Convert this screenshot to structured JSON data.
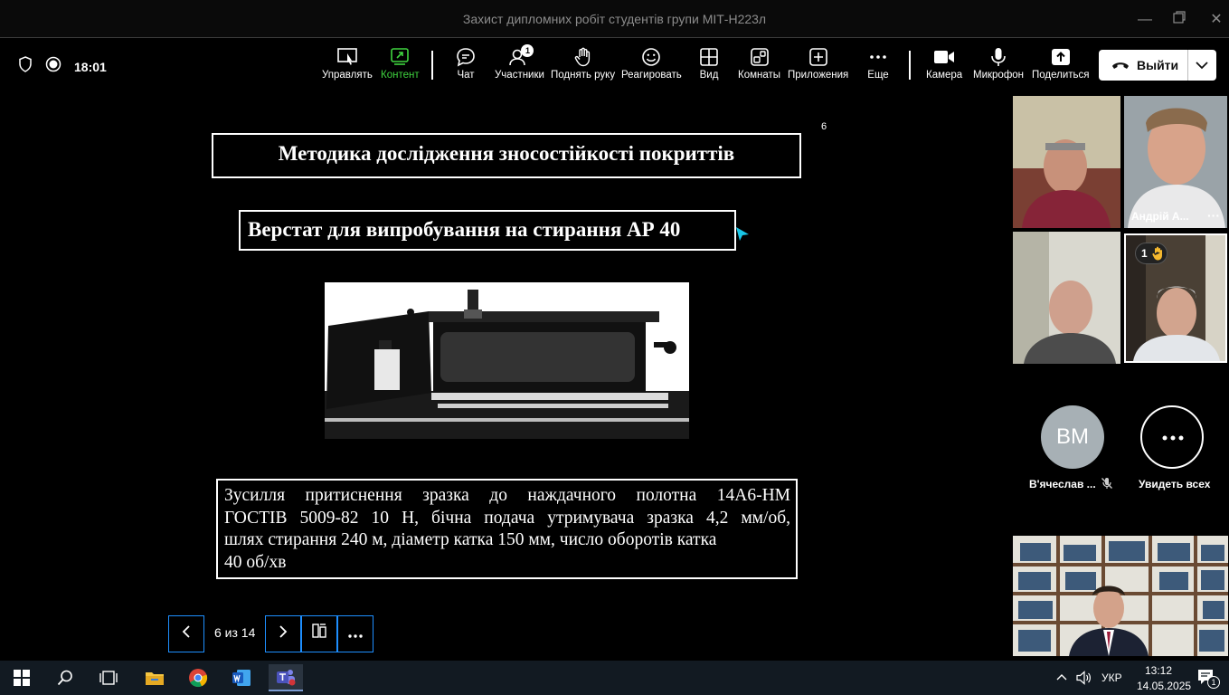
{
  "window": {
    "title": "Захист дипломних робіт студентів групи МІТ-Н223л"
  },
  "status": {
    "time": "18:01"
  },
  "toolbar": {
    "items": [
      {
        "label": "Управлять",
        "icon": "screen-control-icon"
      },
      {
        "label": "Контент",
        "icon": "share-content-icon"
      },
      {
        "label": "Чат",
        "icon": "chat-icon"
      },
      {
        "label": "Участники",
        "icon": "participants-icon",
        "badge": "1"
      },
      {
        "label": "Поднять руку",
        "icon": "raise-hand-icon"
      },
      {
        "label": "Реагировать",
        "icon": "react-icon"
      },
      {
        "label": "Вид",
        "icon": "view-grid-icon"
      },
      {
        "label": "Комнаты",
        "icon": "rooms-icon"
      },
      {
        "label": "Приложения",
        "icon": "apps-icon"
      },
      {
        "label": "Еще",
        "icon": "more-icon"
      },
      {
        "label": "Камера",
        "icon": "camera-icon"
      },
      {
        "label": "Микрофон",
        "icon": "mic-icon"
      },
      {
        "label": "Поделиться",
        "icon": "share-icon"
      }
    ],
    "leave_label": "Выйти",
    "accent_color": "#3fd43f"
  },
  "slide": {
    "number": "6",
    "title": "Методика дослідження зносостійкості покриттів",
    "subtitle": "Верстат для випробування на стирання АР 40",
    "description_lines": [
      "Зусилля притиснення зразка до наждачного полотна 14А6-НМ",
      "ГОСТІВ 5009-82  10 Н, бічна подача утримувача зразка 4,2 мм/об,",
      "шлях стирання 240 м, діаметр катка 150 мм, число оборотів катка",
      "40 об/хв"
    ]
  },
  "slide_nav": {
    "page_label": "6 из 14"
  },
  "participants": {
    "tile2_name": "Андрій А...",
    "tile4_hand_count": "1",
    "avatar_initials": "ВМ",
    "avatar_name": "В'ячеслав ...",
    "see_all_label": "Увидеть всех"
  },
  "taskbar": {
    "language": "УКР",
    "clock_time": "13:12",
    "clock_date": "14.05.2025",
    "notification_count": "1"
  }
}
